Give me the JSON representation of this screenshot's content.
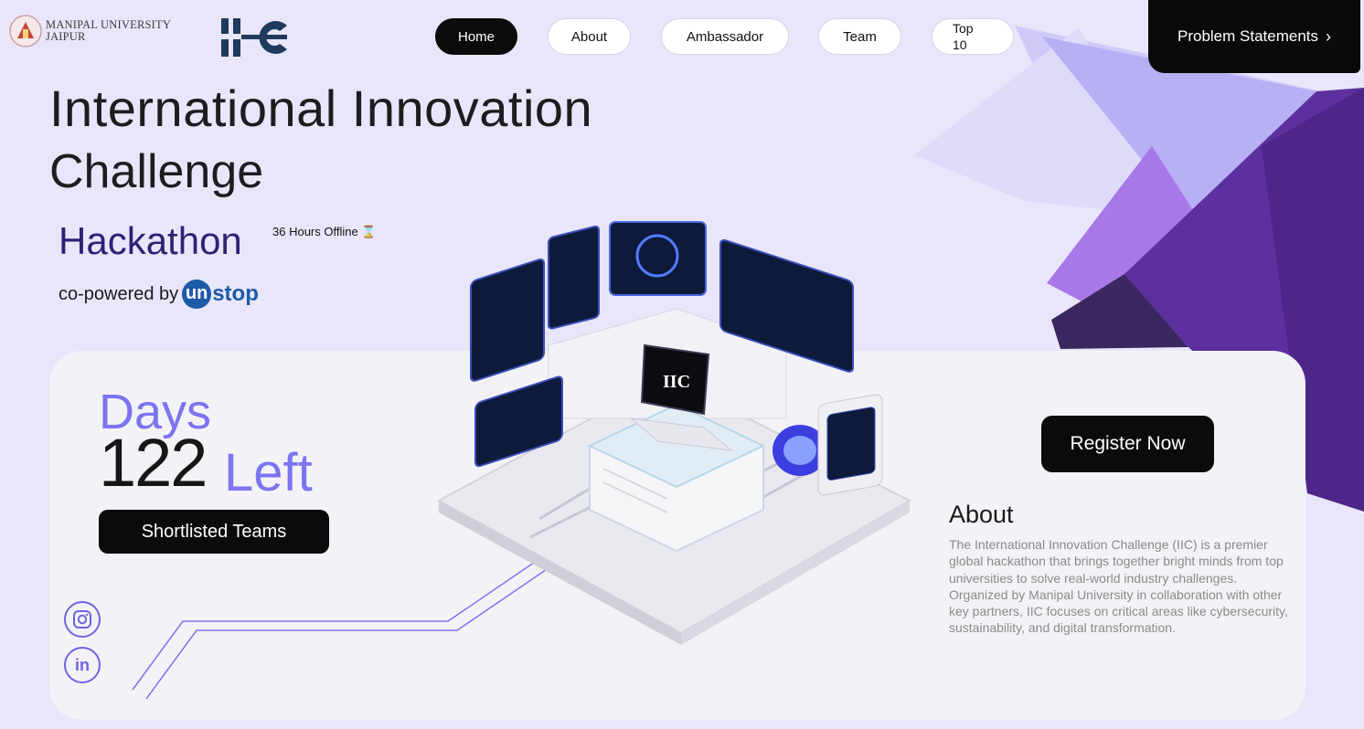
{
  "header": {
    "university": {
      "line1": "MANIPAL UNIVERSITY",
      "line2": "JAIPUR"
    },
    "logo_text": "IIC",
    "nav": [
      {
        "label": "Home",
        "active": true
      },
      {
        "label": "About",
        "active": false
      },
      {
        "label": "Ambassador",
        "active": false
      },
      {
        "label": "Team",
        "active": false
      },
      {
        "label": "Top 10",
        "active": false
      }
    ],
    "cta": {
      "label": "Problem Statements",
      "icon": "chevron-right-icon"
    }
  },
  "hero": {
    "title_line1": "International Innovation",
    "title_line2": "Challenge",
    "subtitle": "Hackathon",
    "subtitle_note": "36 Hours Offline",
    "subtitle_icon": "hourglass-icon",
    "powered_prefix": "co-powered by",
    "powered_brand_u": "un",
    "powered_brand_rest": "stop"
  },
  "countdown": {
    "days_label": "Days",
    "days_value": "122",
    "left_label": "Left",
    "shortlisted_button": "Shortlisted Teams"
  },
  "illustration": {
    "screen_label": "IIC"
  },
  "social": [
    {
      "name": "instagram-icon"
    },
    {
      "name": "linkedin-icon",
      "text": "in"
    }
  ],
  "register_button": "Register Now",
  "about": {
    "heading": "About",
    "body": "The International Innovation Challenge (IIC) is a premier global hackathon that brings together bright minds from top universities to solve real-world industry challenges. Organized by Manipal University in collaboration with other key partners, IIC focuses on critical areas like cybersecurity, sustainability, and digital transformation."
  },
  "colors": {
    "background": "#e9e6fb",
    "accent_purple": "#7d74f1",
    "deep_purple": "#2e2274",
    "button_dark": "#0b0b0b",
    "unstop_blue": "#1d5aa8"
  }
}
